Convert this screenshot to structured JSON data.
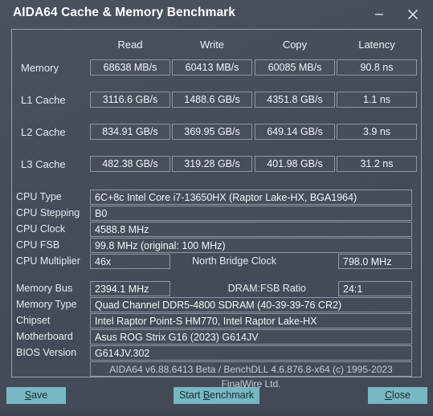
{
  "window": {
    "title": "AIDA64 Cache & Memory Benchmark",
    "minimize_label": "Minimize",
    "close_label": "Close"
  },
  "benchmark": {
    "columns": [
      "Read",
      "Write",
      "Copy",
      "Latency"
    ],
    "rows": [
      {
        "label": "Memory",
        "read": "68638 MB/s",
        "write": "60413 MB/s",
        "copy": "60085 MB/s",
        "latency": "90.8 ns"
      },
      {
        "label": "L1 Cache",
        "read": "3116.6 GB/s",
        "write": "1488.6 GB/s",
        "copy": "4351.8 GB/s",
        "latency": "1.1 ns"
      },
      {
        "label": "L2 Cache",
        "read": "834.91 GB/s",
        "write": "369.95 GB/s",
        "copy": "649.14 GB/s",
        "latency": "3.9 ns"
      },
      {
        "label": "L3 Cache",
        "read": "482.38 GB/s",
        "write": "319.28 GB/s",
        "copy": "401.98 GB/s",
        "latency": "31.2 ns"
      }
    ]
  },
  "cpu_info": {
    "cpu_type_label": "CPU Type",
    "cpu_type_value": "6C+8c Intel Core i7-13650HX  (Raptor Lake-HX, BGA1964)",
    "cpu_stepping_label": "CPU Stepping",
    "cpu_stepping_value": "B0",
    "cpu_clock_label": "CPU Clock",
    "cpu_clock_value": "4588.8 MHz",
    "cpu_fsb_label": "CPU FSB",
    "cpu_fsb_value": "99.8 MHz  (original: 100 MHz)",
    "cpu_multiplier_label": "CPU Multiplier",
    "cpu_multiplier_value": "46x",
    "north_bridge_clock_label": "North Bridge Clock",
    "north_bridge_clock_value": "798.0 MHz"
  },
  "memory_info": {
    "memory_bus_label": "Memory Bus",
    "memory_bus_value": "2394.1 MHz",
    "dram_fsb_ratio_label": "DRAM:FSB Ratio",
    "dram_fsb_ratio_value": "24:1",
    "memory_type_label": "Memory Type",
    "memory_type_value": "Quad Channel DDR5-4800 SDRAM  (40-39-39-76 CR2)",
    "chipset_label": "Chipset",
    "chipset_value": "Intel Raptor Point-S HM770, Intel Raptor Lake-HX",
    "motherboard_label": "Motherboard",
    "motherboard_value": "Asus ROG Strix G16 (2023) G614JV",
    "bios_version_label": "BIOS Version",
    "bios_version_value": "G614JV.302"
  },
  "footer": {
    "version_text": "AIDA64 v6.88.6413 Beta / BenchDLL 4.6.876.8-x64  (c) 1995-2023 FinalWire Ltd."
  },
  "buttons": {
    "save": {
      "prefix": "",
      "accel": "S",
      "suffix": "ave"
    },
    "start_benchmark": {
      "prefix": "Start ",
      "accel": "B",
      "suffix": "enchmark"
    },
    "close": {
      "prefix": "",
      "accel": "C",
      "suffix": "lose"
    }
  },
  "colors": {
    "window_background": "#454d5a",
    "panel_border": "#98a0ab",
    "cell_border": "#8d96a2",
    "button_accent": "#77b8c4",
    "button_text": "#1d2b33",
    "text_primary": "#f2f5f8"
  }
}
